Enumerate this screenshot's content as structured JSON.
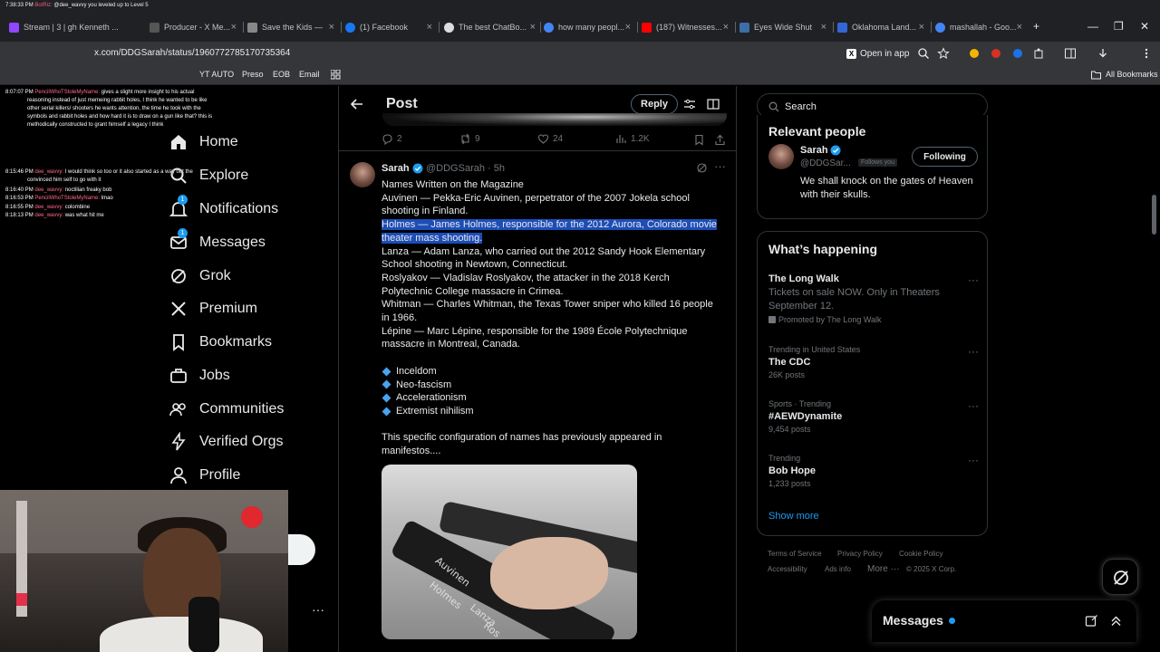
{
  "browser": {
    "tabs": [
      {
        "label": "Stream | 3 | gh Kenneth ..."
      },
      {
        "label": "Producer - X Me..."
      },
      {
        "label": "Save the Kids —"
      },
      {
        "label": "(1) Facebook"
      },
      {
        "label": "The best ChatBo..."
      },
      {
        "label": "how many peopl..."
      },
      {
        "label": "(187) Witnesses..."
      },
      {
        "label": "Eyes Wide Shut"
      },
      {
        "label": "Oklahoma Land..."
      },
      {
        "label": "mashallah - Goo..."
      }
    ],
    "url": "x.com/DDGSarah/status/1960772785170735364",
    "open_in_app": "Open in app",
    "bookmarks": [
      "YT AUTO",
      "Preso",
      "EOB",
      "Email"
    ],
    "all_bookmarks": "All Bookmarks"
  },
  "chat_overlay": [
    {
      "time": "7:38:33 PM",
      "name": "BotRiz:",
      "text": "@dee_wavvy you leveled up to Level 5"
    },
    {
      "time": "8:07:07 PM",
      "name": "PencilWhoTStoleMyName:",
      "text": "gives a slight more insight to his actual"
    },
    {
      "time": "",
      "name": "",
      "text": "reasoning instead of just memeing rabbit holes, I think he wanted to be like"
    },
    {
      "time": "",
      "name": "",
      "text": "other serial killers/ shooters he wants attention, the time he took with the"
    },
    {
      "time": "",
      "name": "",
      "text": "symbols and rabbit holes and how hard it is to draw on a gun like that? this is"
    },
    {
      "time": "",
      "name": "",
      "text": "methodically constructed to grant himself a legacy I think"
    },
    {
      "time": "8:15:46 PM",
      "name": "dee_wavvy:",
      "text": "I would think so too or it also started as a way out the"
    },
    {
      "time": "",
      "name": "",
      "text": "convinced him self to go with it"
    },
    {
      "time": "8:16:40 PM",
      "name": "dee_wavvy:",
      "text": "noctilian freaky bob"
    },
    {
      "time": "8:16:53 PM",
      "name": "PencilWhoTStoleMyName:",
      "text": "lmao"
    },
    {
      "time": "8:16:55 PM",
      "name": "dee_wavvy:",
      "text": "colombine"
    },
    {
      "time": "8:18:13 PM",
      "name": "dee_wavvy:",
      "text": "was what hit me"
    }
  ],
  "nav": {
    "home": "Home",
    "explore": "Explore",
    "notifications": "Notifications",
    "messages": "Messages",
    "grok": "Grok",
    "premium": "Premium",
    "bookmarks": "Bookmarks",
    "jobs": "Jobs",
    "communities": "Communities",
    "verified_orgs": "Verified Orgs",
    "profile": "Profile",
    "notifications_badge": "1",
    "messages_badge": "1"
  },
  "post_header": {
    "title": "Post",
    "reply": "Reply"
  },
  "prev_actions": {
    "replies": "2",
    "reposts": "9",
    "likes": "24",
    "views": "1.2K"
  },
  "tweet": {
    "name": "Sarah",
    "handle": "@DDGSarah · 5h",
    "lines": [
      {
        "text": "Names Written on the Magazine",
        "highlight": false
      },
      {
        "text": "Auvinen — Pekka-Eric Auvinen, perpetrator of the 2007 Jokela school",
        "highlight": false
      },
      {
        "text": "shooting in Finland.",
        "highlight": false
      },
      {
        "text": "Holmes — James Holmes, responsible for the 2012 Aurora, Colorado movie",
        "highlight": true
      },
      {
        "text": "theater mass shooting.",
        "highlight": true
      },
      {
        "text": "Lanza — Adam Lanza, who carried out the 2012 Sandy Hook Elementary",
        "highlight": false
      },
      {
        "text": "School shooting in Newtown, Connecticut.",
        "highlight": false
      },
      {
        "text": "Roslyakov — Vladislav Roslyakov, the attacker in the 2018 Kerch",
        "highlight": false
      },
      {
        "text": "Polytechnic College massacre in Crimea.",
        "highlight": false
      },
      {
        "text": "Whitman — Charles Whitman, the Texas Tower sniper who killed 16 people",
        "highlight": false
      },
      {
        "text": "in 1966.",
        "highlight": false
      },
      {
        "text": "Lépine — Marc Lépine, responsible for the 1989 École Polytechnique",
        "highlight": false
      },
      {
        "text": "massacre in Montreal, Canada.",
        "highlight": false
      }
    ],
    "bullets": [
      "Inceldom",
      "Neo-fascism",
      "Accelerationism",
      "Extremist nihilism"
    ],
    "closing": [
      "This specific configuration of names has previously appeared in",
      "manifestos...."
    ],
    "image_words": [
      "Auvinen",
      "Holmes",
      "Lanza",
      "Ros"
    ]
  },
  "search": {
    "placeholder": "Search"
  },
  "relevant_people": {
    "title": "Relevant people",
    "name": "Sarah",
    "handle": "@DDGSar...",
    "follows_you": "Follows you",
    "button": "Following",
    "bio": "We shall knock on the gates of Heaven with their skulls."
  },
  "whats_happening": {
    "title": "What’s happening",
    "trends": [
      {
        "meta": "",
        "name": "The Long Walk",
        "sub": "Tickets on sale NOW. Only in Theaters September 12.",
        "promo": "Promoted by The Long Walk"
      },
      {
        "meta": "Trending in United States",
        "name": "The CDC",
        "sub": "26K posts",
        "promo": ""
      },
      {
        "meta": "Sports · Trending",
        "name": "#AEWDynamite",
        "sub": "9,454 posts",
        "promo": ""
      },
      {
        "meta": "Trending",
        "name": "Bob Hope",
        "sub": "1,233 posts",
        "promo": ""
      }
    ],
    "show_more": "Show more"
  },
  "footer": [
    "Terms of Service",
    "Privacy Policy",
    "Cookie Policy",
    "Accessibility",
    "Ads info",
    "More ···",
    "© 2025 X Corp."
  ],
  "messages_drawer": {
    "title": "Messages"
  }
}
